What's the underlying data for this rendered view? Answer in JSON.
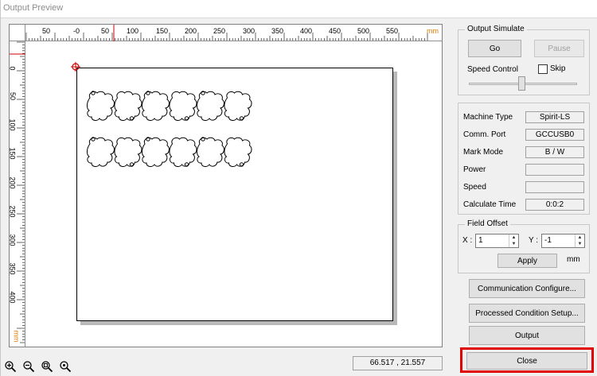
{
  "window": {
    "title": "Output Preview"
  },
  "ruler": {
    "unit": "mm",
    "top_ticks": [
      "50",
      "-0",
      "50",
      "100",
      "150",
      "200",
      "250",
      "300",
      "350",
      "400",
      "450",
      "500",
      "550"
    ],
    "left_ticks": [
      "0",
      "50",
      "100",
      "150",
      "200",
      "250",
      "300",
      "350",
      "400"
    ],
    "left_unit": "mm"
  },
  "status": {
    "coordinates": "66.517 , 21.557"
  },
  "zoom_icons": [
    "zoom-in-icon",
    "zoom-out-icon",
    "zoom-fit-icon",
    "zoom-actual-icon"
  ],
  "simulate": {
    "title": "Output  Simulate",
    "go_label": "Go",
    "pause_label": "Pause",
    "speed_label": "Speed Control",
    "skip_label": "Skip",
    "skip_checked": false,
    "speed_level": 0.46
  },
  "machine": {
    "rows": [
      {
        "label": "Machine Type",
        "value": "Spirit-LS"
      },
      {
        "label": "Comm. Port",
        "value": "GCCUSB0"
      },
      {
        "label": "Mark Mode",
        "value": "B  /  W"
      },
      {
        "label": "Power",
        "value": ""
      },
      {
        "label": "Speed",
        "value": ""
      },
      {
        "label": "Calculate Time",
        "value": "0:0:2"
      }
    ]
  },
  "offset": {
    "title": "Field Offset",
    "x_label": "X :",
    "x_value": "1",
    "y_label": "Y :",
    "y_value": "-1",
    "apply_label": "Apply",
    "unit": "mm"
  },
  "actions": {
    "comm_label": "Communication Configure...",
    "process_label": "Processed Condition Setup...",
    "output_label": "Output",
    "close_label": "Close"
  },
  "colors": {
    "highlight": "#e00000",
    "ruler_unit": "#e07a00",
    "origin": "#cc0000"
  }
}
